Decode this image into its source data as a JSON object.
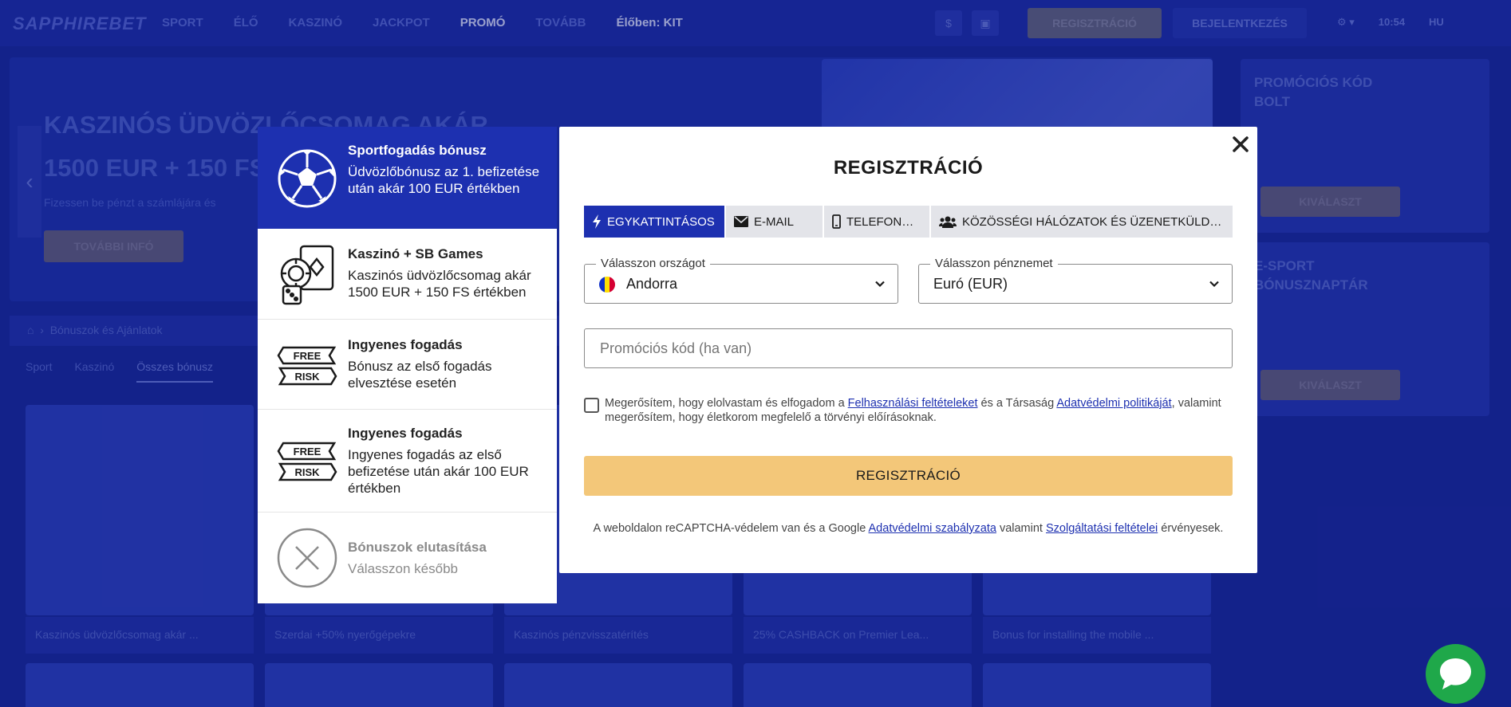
{
  "background": {
    "logo": "SAPPHIREBET",
    "nav": [
      "SPORT",
      "ÉLŐ",
      "KASZINÓ",
      "JACKPOT",
      "PROMÓ",
      "TOVÁBB",
      "Élőben: KIT"
    ],
    "register_label": "REGISZTRÁCIÓ",
    "login_label": "BEJELENTKEZÉS",
    "time": "10:54",
    "language": "HU",
    "hero_title": "KASZINÓS ÜDVÖZLŐCSOMAG AKÁR 1500 EUR + 150 FS",
    "hero_subtitle": "Fizessen be pénzt a számlájára és",
    "hero_button": "TOVÁBBI INFÓ",
    "side_promo_title": "PROMÓCIÓS KÓD BOLT",
    "side_promo_button": "KIVÁLASZT",
    "side_calendar_title": "E-SPORT BÓNUSZNAPTÁR",
    "side_calendar_button": "KIVÁLASZT",
    "breadcrumb": "Bónuszok és Ajánlatok",
    "tabs": [
      "Sport",
      "Kaszinó",
      "Összes bónusz"
    ],
    "cards": [
      "Kaszinós üdvözlőcsomag akár ...",
      "Szerdai +50% nyerőgépekre",
      "Kaszinós pénzvisszatérítés",
      "25% CASHBACK on Premier Lea...",
      "Bonus for installing the mobile ..."
    ]
  },
  "bonuses": [
    {
      "title": "Sportfogadás bónusz",
      "description": "Üdvözlőbónusz az 1. befizetése után akár 100 EUR értékben",
      "icon": "soccer-ball-icon",
      "active": true
    },
    {
      "title": "Kaszinó + SB Games",
      "description": "Kaszinós üdvözlőcsomag akár 1500 EUR + 150 FS értékben",
      "icon": "casino-chips-icon",
      "active": false
    },
    {
      "title": "Ingyenes fogadás",
      "description": "Bónusz az első fogadás elvesztése esetén",
      "icon": "free-risk-icon",
      "active": false
    },
    {
      "title": "Ingyenes fogadás",
      "description": "Ingyenes fogadás az első befizetése után akár 100 EUR értékben",
      "icon": "free-risk-icon",
      "active": false
    },
    {
      "title": "Bónuszok elutasítása",
      "description": "Válasszon később",
      "icon": "decline-icon",
      "active": false
    }
  ],
  "free_label": "FREE",
  "risk_label": "RISK",
  "modal": {
    "title": "REGISZTRÁCIÓ",
    "tabs": [
      {
        "label": "EGYKATTINTÁSOS",
        "icon": "lightning-icon"
      },
      {
        "label": "E-MAIL",
        "icon": "envelope-icon"
      },
      {
        "label": "TELEFONSZÁM",
        "icon": "phone-icon"
      },
      {
        "label": "KÖZÖSSÉGI HÁLÓZATOK ÉS ÜZENETKÜLDŐK",
        "icon": "users-icon"
      }
    ],
    "country_label": "Válasszon országot",
    "country_value": "Andorra",
    "currency_label": "Válasszon pénznemet",
    "currency_value": "Euró (EUR)",
    "promo_placeholder": "Promóciós kód (ha van)",
    "consent_prefix": "Megerősítem, hogy elolvastam és elfogadom a ",
    "consent_terms_link": "Felhasználási feltételeket",
    "consent_middle": " és a Társaság ",
    "consent_privacy_link": "Adatvédelmi politikáját",
    "consent_suffix": ", valamint megerősítem, hogy életkorom megfelelő a törvényi előírásoknak.",
    "register_button": "REGISZTRÁCIÓ",
    "recaptcha_prefix": "A weboldalon reCAPTCHA-védelem van és a Google ",
    "recaptcha_privacy_link": "Adatvédelmi szabályzata",
    "recaptcha_middle": " valamint ",
    "recaptcha_terms_link": "Szolgáltatási feltételei",
    "recaptcha_suffix": " érvényesek."
  },
  "colors": {
    "brand_blue": "#1d30b0",
    "register_yellow": "#f3c779",
    "chat_green": "#1fa84a"
  }
}
